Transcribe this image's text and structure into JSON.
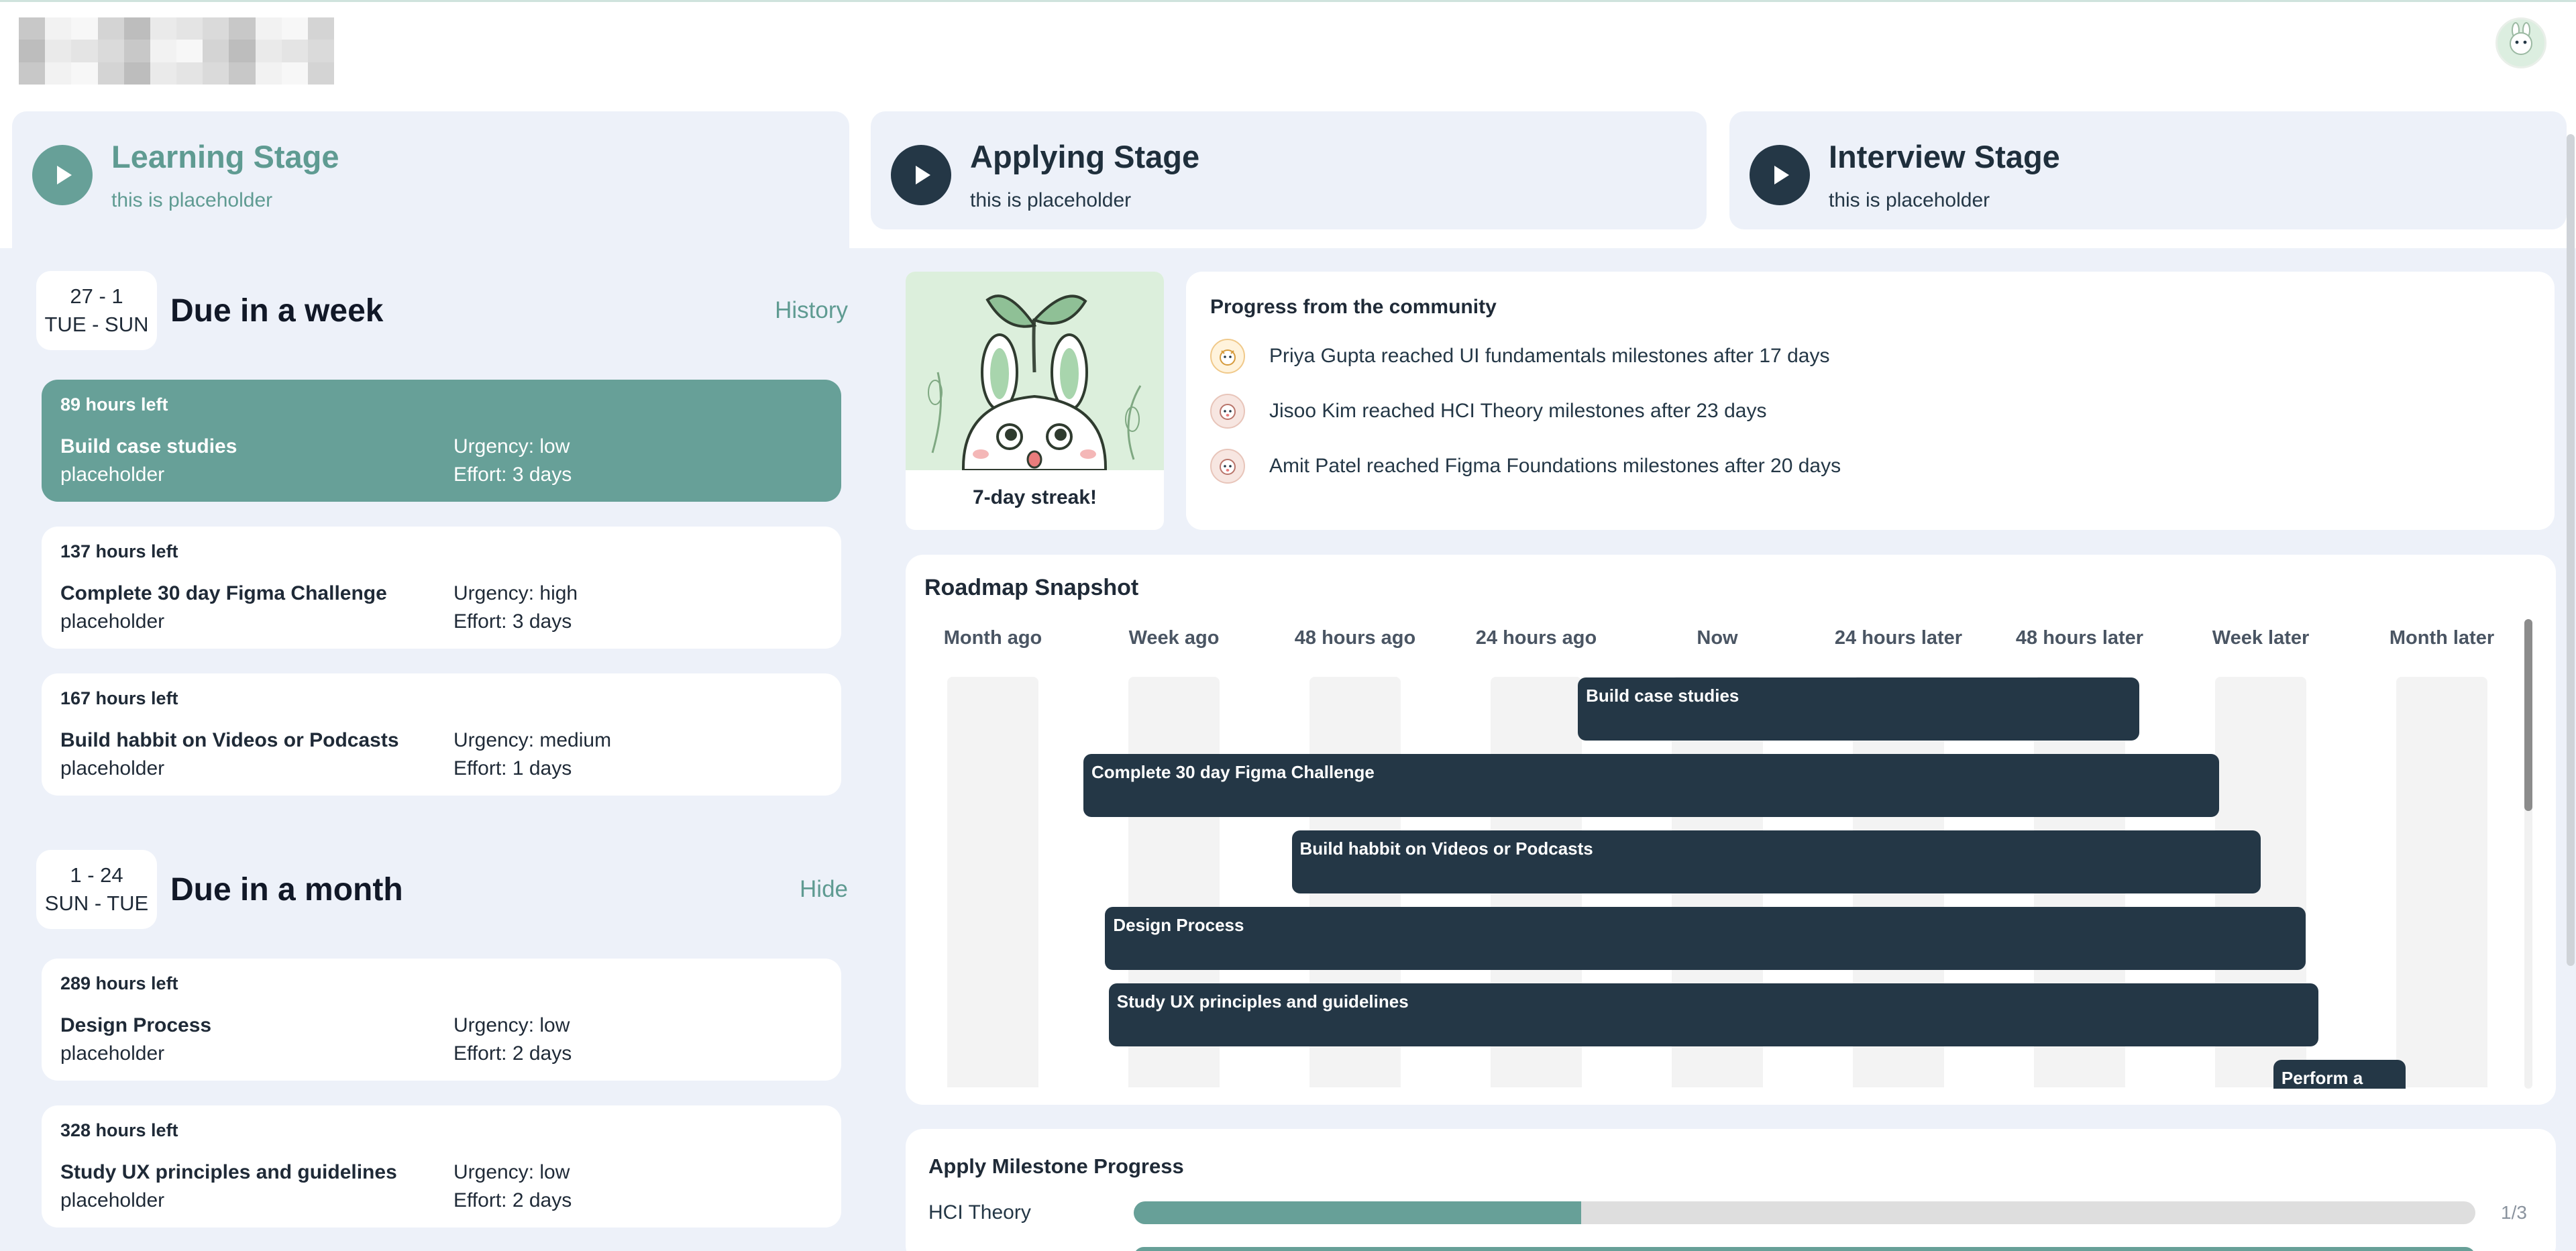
{
  "colors": {
    "accent": "#67a098",
    "accent_text": "#5f9b92",
    "dark": "#243746",
    "panel_bg": "#edf1f9"
  },
  "header": {
    "avatar_icon": "bunny-avatar-icon"
  },
  "stages": [
    {
      "title": "Learning Stage",
      "subtitle": "this is placeholder",
      "active": true
    },
    {
      "title": "Applying Stage",
      "subtitle": "this is placeholder",
      "active": false
    },
    {
      "title": "Interview Stage",
      "subtitle": "this is placeholder",
      "active": false
    }
  ],
  "due_week": {
    "date_range": "27 - 1",
    "day_range": "TUE - SUN",
    "title": "Due in a week",
    "link": "History",
    "tasks": [
      {
        "hours": "89 hours left",
        "name": "Build case studies",
        "note": "placeholder",
        "urgency": "Urgency: low",
        "effort": "Effort: 3 days"
      },
      {
        "hours": "137 hours left",
        "name": "Complete 30 day Figma Challenge",
        "note": "placeholder",
        "urgency": "Urgency: high",
        "effort": "Effort: 3 days"
      },
      {
        "hours": "167 hours left",
        "name": "Build habbit on Videos or Podcasts",
        "note": "placeholder",
        "urgency": "Urgency: medium",
        "effort": "Effort: 1 days"
      }
    ]
  },
  "due_month": {
    "date_range": "1 - 24",
    "day_range": "SUN - TUE",
    "title": "Due in a month",
    "link": "Hide",
    "tasks": [
      {
        "hours": "289 hours left",
        "name": "Design Process",
        "note": "placeholder",
        "urgency": "Urgency: low",
        "effort": "Effort: 2 days"
      },
      {
        "hours": "328 hours left",
        "name": "Study UX principles and guidelines",
        "note": "placeholder",
        "urgency": "Urgency: low",
        "effort": "Effort: 2 days"
      }
    ]
  },
  "streak": {
    "caption": "7-day streak!"
  },
  "community": {
    "title": "Progress from the community",
    "items": [
      {
        "text": "Priya Gupta reached UI fundamentals milestones after 17 days"
      },
      {
        "text": "Jisoo Kim reached HCI Theory milestones after 23 days"
      },
      {
        "text": "Amit Patel reached Figma Foundations milestones after 20 days"
      }
    ]
  },
  "roadmap": {
    "title": "Roadmap Snapshot",
    "labels": [
      "Month ago",
      "Week ago",
      "48 hours ago",
      "24 hours ago",
      "Now",
      "24 hours later",
      "48 hours later",
      "Week later",
      "Month later"
    ],
    "bars": [
      {
        "label": "Build case studies",
        "start": 3.23,
        "end": 6.33
      },
      {
        "label": "Complete 30 day Figma Challenge",
        "start": 0.5,
        "end": 6.77
      },
      {
        "label": "Build habbit on Videos or Podcasts",
        "start": 1.65,
        "end": 7.0
      },
      {
        "label": "Design Process",
        "start": 0.62,
        "end": 7.25
      },
      {
        "label": "Study UX principles and guidelines",
        "start": 0.64,
        "end": 7.32
      },
      {
        "label": "Perform a",
        "start": 7.07,
        "end": 7.8
      }
    ]
  },
  "milestones": {
    "title": "Apply Milestone Progress",
    "items": [
      {
        "name": "HCI Theory",
        "done": 1,
        "total": 3,
        "count": "1/3"
      }
    ]
  }
}
